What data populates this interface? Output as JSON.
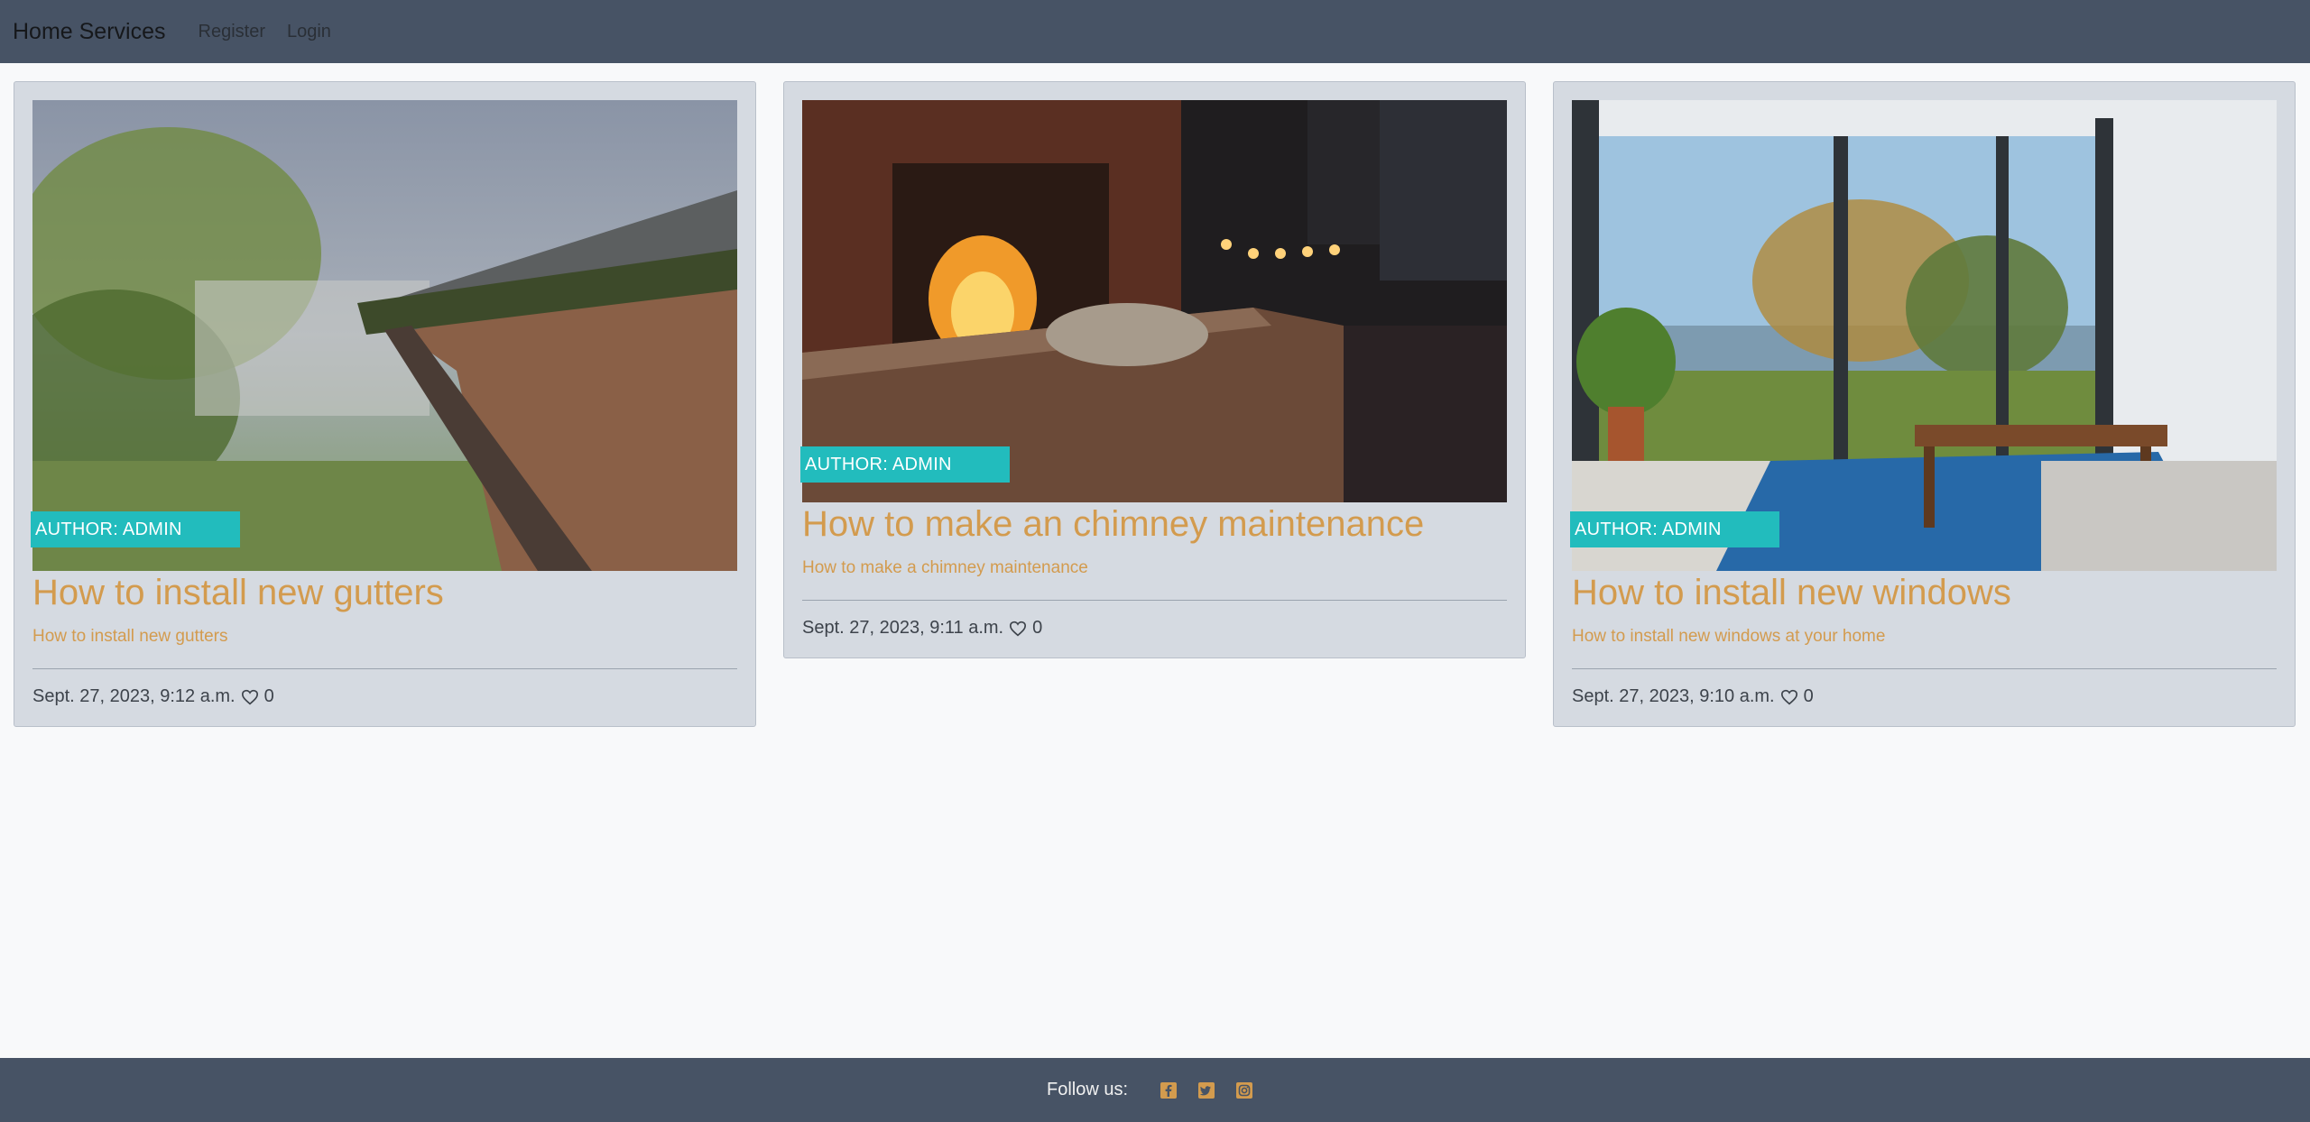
{
  "navbar": {
    "brand": "Home Services",
    "links": [
      "Register",
      "Login"
    ]
  },
  "posts": [
    {
      "author": "AUTHOR: ADMIN",
      "title": "How to install new gutters",
      "description": "How to install new gutters",
      "date": "Sept. 27, 2023, 9:12 a.m.",
      "likes": "0"
    },
    {
      "author": "AUTHOR: ADMIN",
      "title": "How to make an chimney maintenance",
      "description": "How to make a chimney maintenance",
      "date": "Sept. 27, 2023, 9:11 a.m.",
      "likes": "0"
    },
    {
      "author": "AUTHOR: ADMIN",
      "title": "How to install new windows",
      "description": "How to install new windows at your home",
      "date": "Sept. 27, 2023, 9:10 a.m.",
      "likes": "0"
    }
  ],
  "footer": {
    "follow_label": "Follow us:",
    "social_icons": [
      "facebook-icon",
      "twitter-icon",
      "instagram-icon"
    ]
  },
  "colors": {
    "navbar_bg": "#475365",
    "card_bg": "#d5dae1",
    "accent_title": "#d39b4e",
    "author_tag": "#22bcbd"
  }
}
